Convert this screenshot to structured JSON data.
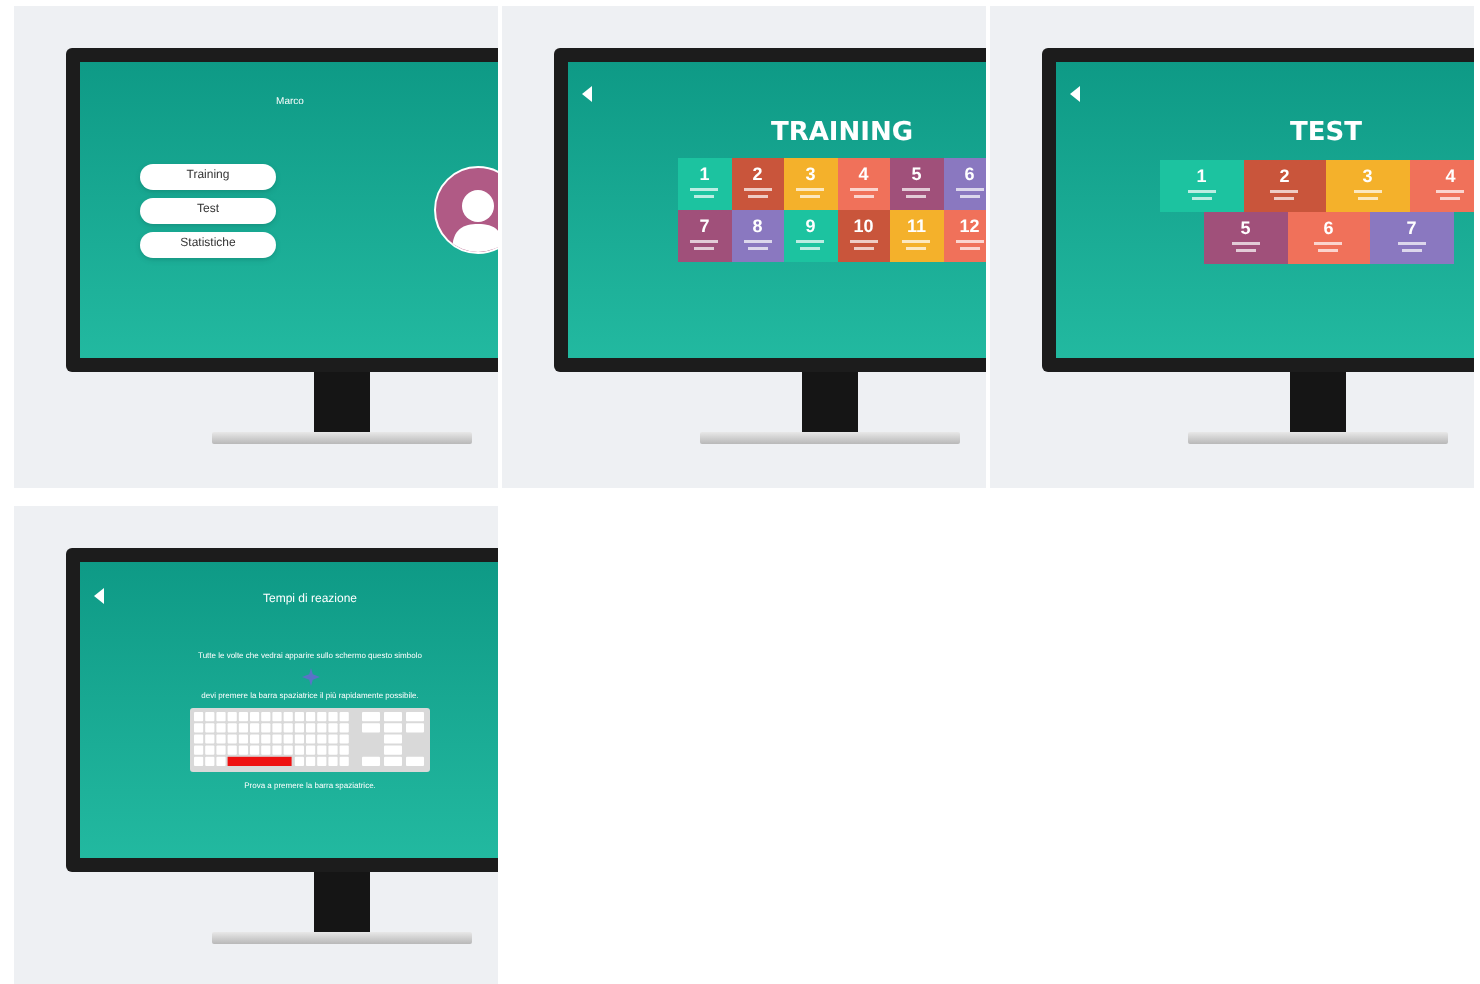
{
  "panels": [
    {
      "kind": "menu",
      "user": "Marco",
      "buttons": [
        "Training",
        "Test",
        "Statistiche"
      ]
    },
    {
      "kind": "training",
      "title": "TRAINING",
      "tiles": [
        {
          "number": "1",
          "color": "#1cc3a0"
        },
        {
          "number": "2",
          "color": "#c9553b"
        },
        {
          "number": "3",
          "color": "#f4b12b"
        },
        {
          "number": "4",
          "color": "#f0715a"
        },
        {
          "number": "5",
          "color": "#a0507a"
        },
        {
          "number": "6",
          "color": "#8a78c0"
        },
        {
          "number": "7",
          "color": "#a0507a"
        },
        {
          "number": "8",
          "color": "#8a78c0"
        },
        {
          "number": "9",
          "color": "#1cc3a0"
        },
        {
          "number": "10",
          "color": "#c9553b"
        },
        {
          "number": "11",
          "color": "#f4b12b"
        },
        {
          "number": "12",
          "color": "#f0715a"
        }
      ]
    },
    {
      "kind": "test",
      "title": "TEST",
      "tiles": [
        {
          "number": "1",
          "color": "#1cc3a0"
        },
        {
          "number": "2",
          "color": "#c9553b"
        },
        {
          "number": "3",
          "color": "#f4b12b"
        },
        {
          "number": "4",
          "color": "#f0715a"
        },
        {
          "number": "5",
          "color": "#a0507a"
        },
        {
          "number": "6",
          "color": "#f0715a"
        },
        {
          "number": "7",
          "color": "#8a78c0"
        }
      ]
    },
    {
      "kind": "reaction",
      "title": "Tempi di reazione",
      "instruction": "Tutte le volte che vedrai apparire sullo schermo questo simbolo",
      "instruction_2": "devi premere la barra spaziatrice il più rapidamente possibile.",
      "prompt": "Prova a premere la barra spaziatrice."
    }
  ]
}
